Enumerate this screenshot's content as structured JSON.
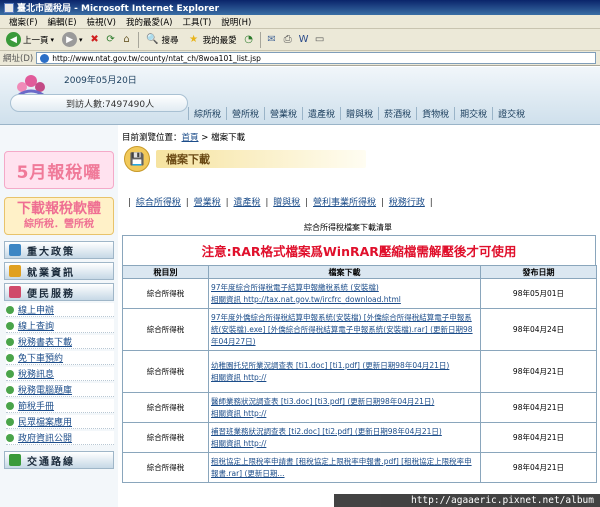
{
  "window": {
    "title": "臺北市國稅局 - Microsoft Internet Explorer"
  },
  "menu": [
    "檔案(F)",
    "編輯(E)",
    "檢視(V)",
    "我的最愛(A)",
    "工具(T)",
    "說明(H)"
  ],
  "toolbar": {
    "back": "上一頁",
    "search": "搜尋",
    "favorites": "我的最愛"
  },
  "address": {
    "label": "網址(D)",
    "url": "http://www.ntat.gov.tw/county/ntat_ch/8woa101_list.jsp"
  },
  "banner": {
    "date": "2009年05月20日",
    "visitors": "到訪人數:7497490人"
  },
  "nav_tabs": [
    "綜所稅",
    "營所稅",
    "營業稅",
    "遺產稅",
    "贈與稅",
    "菸酒稅",
    "貨物稅",
    "期交稅",
    "證交稅"
  ],
  "sidebar": {
    "promo1": "5月報稅囉",
    "promo2_line1": "下載報稅軟體",
    "promo2_line2": "綜所稅．營所稅",
    "section1": "重大政策",
    "section2": "就業資訊",
    "section3": "便民服務",
    "items": [
      "線上申辦",
      "線上查詢",
      "稅務書表下載",
      "免下車預約",
      "稅務訊息",
      "稅務電腦題庫",
      "節稅手冊",
      "民眾檔案應用",
      "政府資訊公開"
    ],
    "section4": "交通路線"
  },
  "breadcrumb": {
    "label": "目前瀏覽位置：",
    "home": "首頁",
    "sep": " > ",
    "current": "檔案下載"
  },
  "page_title": "檔案下載",
  "categories": [
    "綜合所得稅",
    "營業稅",
    "遺產稅",
    "贈與稅",
    "營利事業所得稅",
    "稅務行政"
  ],
  "table_title": "綜合所得稅檔案下載清單",
  "notice": "注意:RAR格式檔案爲WinRAR壓縮檔需解壓後才可使用",
  "table": {
    "headers": [
      "稅目別",
      "檔案下載",
      "發布日期"
    ],
    "rows": [
      {
        "cat": "綜合所得稅",
        "l1": "97年度綜合所得稅電子結算申報繳稅系統 (安裝檔)",
        "l2": "相關資訊 http://tax.nat.gov.tw/ircfrc_download.html",
        "date": "98年05月01日"
      },
      {
        "cat": "綜合所得稅",
        "l1": "97年度外僑綜合所得稅結算申報系統(安裝檔) [外僑綜合所得稅結算電子申報系統(安裝檔).exe] [外僑綜合所得稅結算電子申報系統(安裝檔).rar] (更新日期98年04月27日)",
        "l2": "",
        "date": "98年04月24日"
      },
      {
        "cat": "綜合所得稅",
        "l1": "幼稚園托兒所業況調查表 [ti1.doc] [ti1.pdf] (更新日期98年04月21日)",
        "l2": "相關資訊 http://",
        "date": "98年04月21日"
      },
      {
        "cat": "綜合所得稅",
        "l1": "醫師業務狀況調查表 [ti3.doc] [ti3.pdf] (更新日期98年04月21日)",
        "l2": "相關資訊 http://",
        "date": "98年04月21日"
      },
      {
        "cat": "綜合所得稅",
        "l1": "補習班業務狀況調查表 [ti2.doc] [ti2.pdf] (更新日期98年04月21日)",
        "l2": "相關資訊 http://",
        "date": "98年04月21日"
      },
      {
        "cat": "綜合所得稅",
        "l1": "租稅協定上限稅率申請書 [租稅協定上限稅率申報書.pdf] [租稅協定上限稅率申報書.rar] (更新日期...",
        "l2": "",
        "date": "98年04月21日"
      }
    ]
  },
  "watermark": "http://agaaeric.pixnet.net/album"
}
